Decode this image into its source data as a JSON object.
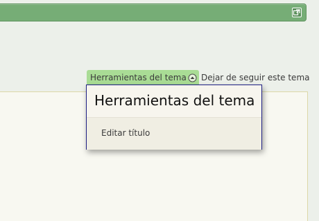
{
  "thread_tools": {
    "trigger_label": "Herramientas del tema",
    "menu_title": "Herramientas del tema",
    "items": [
      {
        "label": "Editar título"
      }
    ]
  },
  "unfollow_label": "Dejar de seguir este tema",
  "icons": {
    "popout": "external-window-icon",
    "toggle": "arrow-up-circle-icon"
  },
  "colors": {
    "top_bar": "#76ad76",
    "trigger_bg": "#a9dc95",
    "menu_border": "#1e1e84",
    "menu_bg": "#f7f5ee",
    "page_bg": "#ecf0ea"
  }
}
